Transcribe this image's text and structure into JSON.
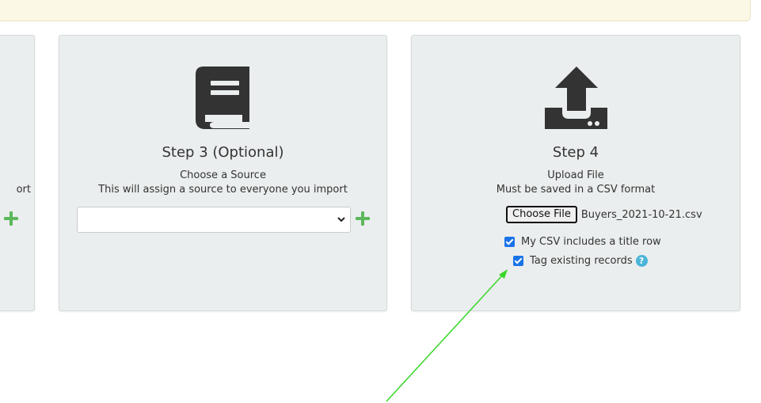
{
  "left_card": {
    "text_fragment": "ort"
  },
  "step3": {
    "title": "Step 3 (Optional)",
    "line1": "Choose a Source",
    "line2": "This will assign a source to everyone you import",
    "select_value": ""
  },
  "step4": {
    "title": "Step 4",
    "line1": "Upload File",
    "line2": "Must be saved in a CSV format",
    "file_button_label": "Choose File",
    "file_name": "Buyers_2021-10-21.csv",
    "checkbox_title_row_label": "My CSV includes a title row",
    "checkbox_title_row_checked": true,
    "checkbox_tag_label": "Tag existing records",
    "checkbox_tag_checked": true,
    "help_symbol": "?"
  },
  "icons": {
    "step3_icon": "book-icon",
    "step4_icon": "upload-icon",
    "add_icon": "plus-icon"
  },
  "colors": {
    "accent_green": "#5cb85c",
    "checkbox_blue": "#1a73e8",
    "help_blue": "#4bb3d8",
    "annotation_arrow": "#39d62a"
  }
}
